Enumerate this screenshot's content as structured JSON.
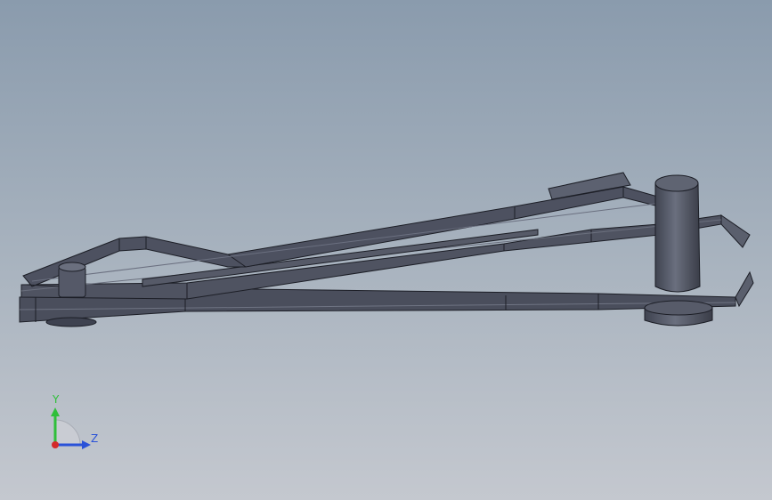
{
  "viewport": {
    "background_top": "#8a9bad",
    "background_bottom": "#c4c8cf",
    "model_color": "#4a4e5c",
    "edge_color": "#1c1e26"
  },
  "triad": {
    "y_label": "Y",
    "z_label": "Z",
    "y_color": "#2fbf3a",
    "z_color": "#2a52d8",
    "x_color": "#d42a2a"
  }
}
